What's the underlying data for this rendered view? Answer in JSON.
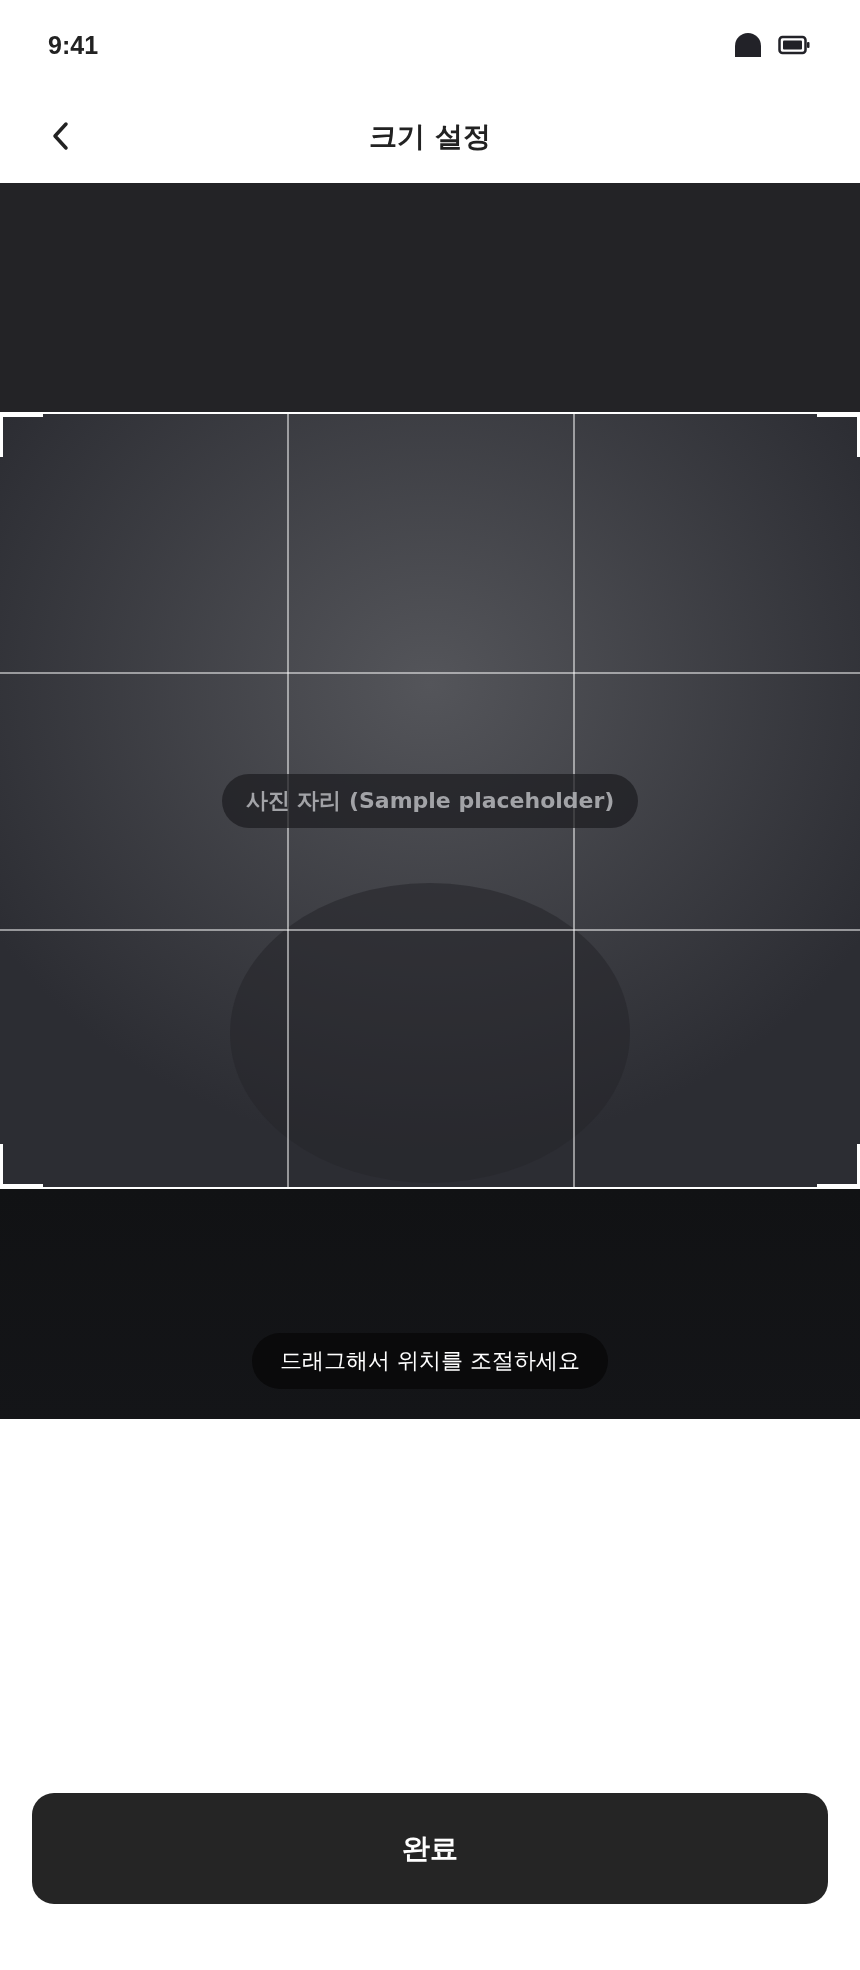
{
  "status_bar": {
    "time": "9:41"
  },
  "header": {
    "title": "크기 설정"
  },
  "editor": {
    "photo_label": "사진 자리 (Sample placeholder)",
    "hint": "드래그해서 위치를 조절하세요"
  },
  "done_button": {
    "label": "완료"
  }
}
